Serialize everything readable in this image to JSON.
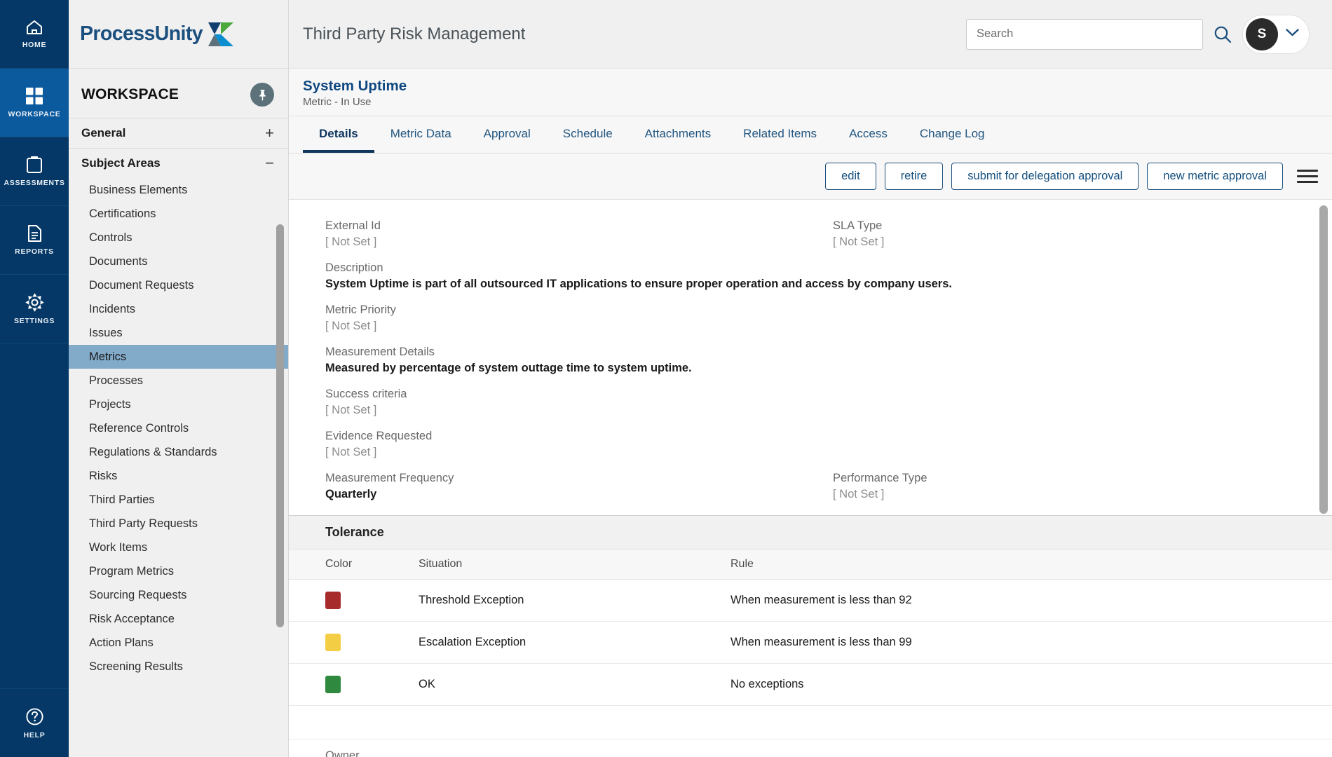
{
  "rail": {
    "items": [
      {
        "label": "HOME",
        "icon": "home-icon",
        "active": false
      },
      {
        "label": "WORKSPACE",
        "icon": "grid-icon",
        "active": true
      },
      {
        "label": "ASSESSMENTS",
        "icon": "clipboard-icon",
        "active": false
      },
      {
        "label": "REPORTS",
        "icon": "document-icon",
        "active": false
      },
      {
        "label": "SETTINGS",
        "icon": "gear-icon",
        "active": false
      }
    ],
    "help": {
      "label": "HELP",
      "icon": "question-circle-icon"
    }
  },
  "brand": {
    "name": "ProcessUnity"
  },
  "sidebar": {
    "title": "WORKSPACE",
    "pin_icon": "pin-icon",
    "groups": [
      {
        "label": "General",
        "toggle": "+"
      },
      {
        "label": "Subject Areas",
        "toggle": "−"
      }
    ],
    "items": [
      {
        "label": "Business Elements",
        "selected": false
      },
      {
        "label": "Certifications",
        "selected": false
      },
      {
        "label": "Controls",
        "selected": false
      },
      {
        "label": "Documents",
        "selected": false
      },
      {
        "label": "Document Requests",
        "selected": false
      },
      {
        "label": "Incidents",
        "selected": false
      },
      {
        "label": "Issues",
        "selected": false
      },
      {
        "label": "Metrics",
        "selected": true
      },
      {
        "label": "Processes",
        "selected": false
      },
      {
        "label": "Projects",
        "selected": false
      },
      {
        "label": "Reference Controls",
        "selected": false
      },
      {
        "label": "Regulations & Standards",
        "selected": false
      },
      {
        "label": "Risks",
        "selected": false
      },
      {
        "label": "Third Parties",
        "selected": false
      },
      {
        "label": "Third Party Requests",
        "selected": false
      },
      {
        "label": "Work Items",
        "selected": false
      },
      {
        "label": "Program Metrics",
        "selected": false
      },
      {
        "label": "Sourcing Requests",
        "selected": false
      },
      {
        "label": "Risk Acceptance",
        "selected": false
      },
      {
        "label": "Action Plans",
        "selected": false
      },
      {
        "label": "Screening Results",
        "selected": false
      }
    ]
  },
  "header": {
    "app_title": "Third Party Risk Management",
    "search": {
      "value": "",
      "placeholder": "Search",
      "icon": "search-icon"
    },
    "avatar": {
      "initial": "S",
      "chevron": "chevron-down-icon"
    }
  },
  "record": {
    "title": "System Uptime",
    "subtitle": "Metric - In Use"
  },
  "tabs": [
    {
      "label": "Details",
      "active": true
    },
    {
      "label": "Metric Data",
      "active": false
    },
    {
      "label": "Approval",
      "active": false
    },
    {
      "label": "Schedule",
      "active": false
    },
    {
      "label": "Attachments",
      "active": false
    },
    {
      "label": "Related Items",
      "active": false
    },
    {
      "label": "Access",
      "active": false
    },
    {
      "label": "Change Log",
      "active": false
    }
  ],
  "actions": {
    "buttons": [
      {
        "label": "edit"
      },
      {
        "label": "retire"
      },
      {
        "label": "submit for delegation approval"
      },
      {
        "label": "new metric approval"
      }
    ],
    "menu_icon": "hamburger-menu-icon"
  },
  "details": {
    "external_id": {
      "label": "External Id",
      "value": "[ Not Set ]",
      "not_set": true
    },
    "sla_type": {
      "label": "SLA Type",
      "value": "[ Not Set ]",
      "not_set": true
    },
    "description": {
      "label": "Description",
      "value": "System Uptime is part of all outsourced IT applications to ensure proper operation and access by company users.",
      "not_set": false
    },
    "metric_priority": {
      "label": "Metric Priority",
      "value": "[ Not Set ]",
      "not_set": true
    },
    "measurement_details": {
      "label": "Measurement Details",
      "value": "Measured by percentage of system outtage time to system uptime.",
      "not_set": false
    },
    "success_criteria": {
      "label": "Success criteria",
      "value": "[ Not Set ]",
      "not_set": true
    },
    "evidence_requested": {
      "label": "Evidence Requested",
      "value": "[ Not Set ]",
      "not_set": true
    },
    "measurement_frequency": {
      "label": "Measurement Frequency",
      "value": "Quarterly",
      "not_set": false
    },
    "performance_type": {
      "label": "Performance Type",
      "value": "[ Not Set ]",
      "not_set": true
    }
  },
  "tolerance": {
    "section_title": "Tolerance",
    "columns": [
      "Color",
      "Situation",
      "Rule"
    ],
    "rows": [
      {
        "color": "#a72b2b",
        "situation": "Threshold Exception",
        "rule": "When measurement is less than 92"
      },
      {
        "color": "#f3ce45",
        "situation": "Escalation Exception",
        "rule": "When measurement is less than 99"
      },
      {
        "color": "#2f8a40",
        "situation": "OK",
        "rule": "No exceptions"
      }
    ]
  },
  "owner": {
    "label": "Owner"
  },
  "colors": {
    "rail_bg": "#053866",
    "rail_active": "#0c5a9e",
    "brand_blue": "#1b4f7e",
    "accent_link": "#15507f",
    "sidebar_selected": "#82aac9"
  }
}
